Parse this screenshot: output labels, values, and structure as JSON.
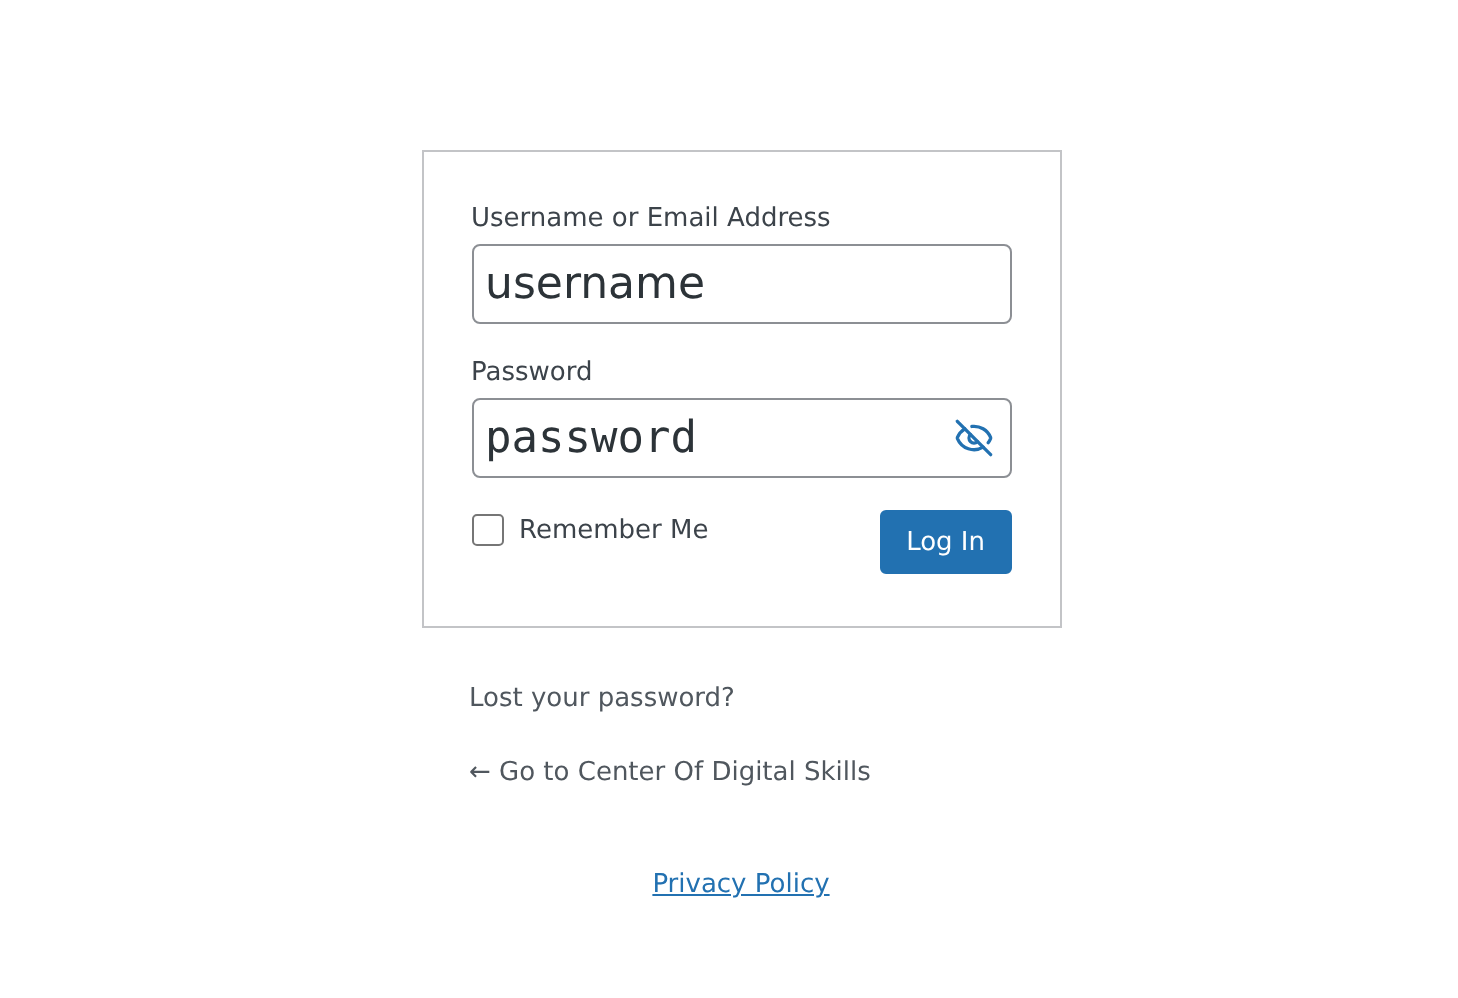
{
  "login_form": {
    "fields": [
      {
        "kind": "text",
        "label": "Username or Email Address",
        "value": "username"
      },
      {
        "kind": "password",
        "label": "Password",
        "value": "password",
        "revealed": true
      }
    ],
    "remember": {
      "label": "Remember Me",
      "checked": false
    },
    "submit": "Log In"
  },
  "nav_links": [
    "Lost your password?",
    "← Go to Center Of Digital Skills"
  ],
  "privacy_link": "Privacy Policy"
}
